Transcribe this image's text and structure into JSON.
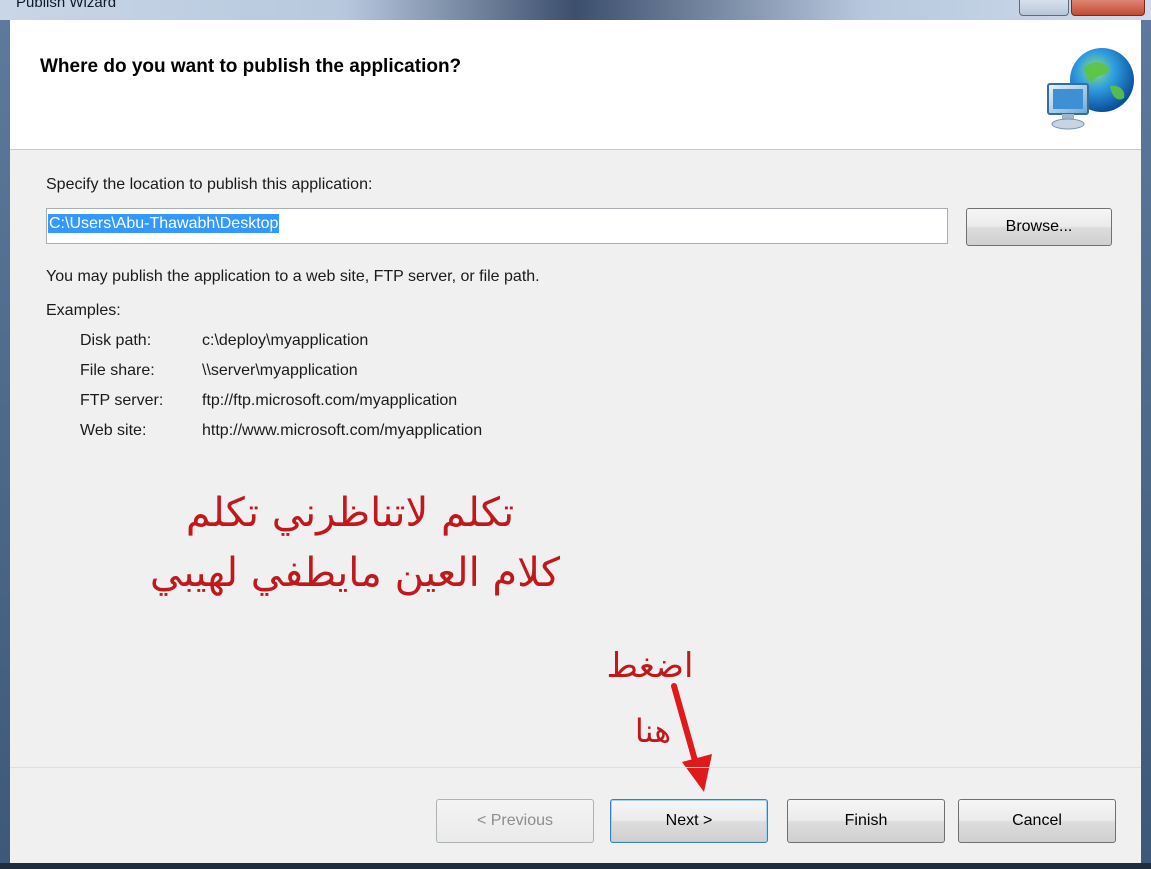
{
  "window": {
    "title": "Publish Wizard"
  },
  "header": {
    "title": "Where do you want to publish the application?",
    "icon": "globe-network-icon"
  },
  "location": {
    "label": "Specify the location to publish this application:",
    "value": "C:\\Users\\Abu-Thawabh\\Desktop",
    "browse_label": "Browse..."
  },
  "info": {
    "text": "You may publish the application to a web site, FTP server, or file path.",
    "examples_label": "Examples:",
    "examples": [
      {
        "label": "Disk path:",
        "value": "c:\\deploy\\myapplication"
      },
      {
        "label": "File share:",
        "value": "\\\\server\\myapplication"
      },
      {
        "label": "FTP server:",
        "value": "ftp://ftp.microsoft.com/myapplication"
      },
      {
        "label": "Web site:",
        "value": "http://www.microsoft.com/myapplication"
      }
    ]
  },
  "annotations": {
    "line1": "تكلم لاتناظرني تكلم",
    "line2": "كلام العين مايطفي لهيبي",
    "press": "اضغط",
    "here": "هنا",
    "color": "#c0181b"
  },
  "buttons": {
    "previous": "< Previous",
    "next": "Next >",
    "finish": "Finish",
    "cancel": "Cancel"
  }
}
